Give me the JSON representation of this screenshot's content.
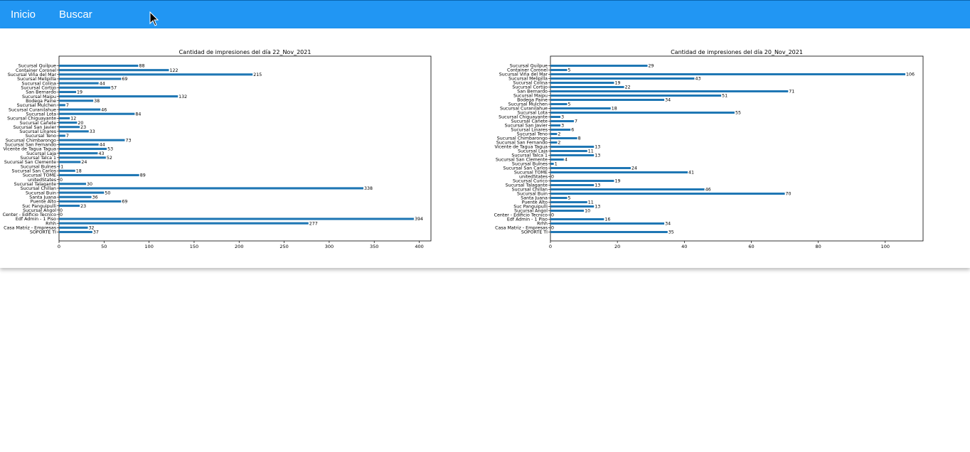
{
  "nav": {
    "inicio_label": "Inicio",
    "buscar_label": "Buscar"
  },
  "colors": {
    "navbar": "#2196f3",
    "bar": "#1f77b4",
    "nav_text": "#ffffff"
  },
  "icons": {
    "cursor": "mouse-pointer-icon"
  },
  "chart_data": [
    {
      "type": "bar",
      "orientation": "horizontal",
      "title": "Cantidad de impresiones del día 22_Nov_2021",
      "xlabel": "",
      "ylabel": "",
      "xlim": [
        0,
        413
      ],
      "xticks": [
        0,
        50,
        100,
        150,
        200,
        250,
        300,
        350,
        400
      ],
      "categories": [
        "Sucursal Quilpue",
        "Container Coronel",
        "Sucursal Viña del Mar",
        "Sucursal Melipilla",
        "Sucursal Colina",
        "Sucursal Cortijo",
        "San Bernardo",
        "Sucursal Maipu",
        "Bodega Paine",
        "Sucursal Mulchen",
        "Sucursal Curanilahue",
        "Sucursal Lota",
        "Sucursal Chiguayante",
        "Sucursal Cañete",
        "Sucursal San Javier",
        "Sucursal Linares",
        "Sucursal Teno",
        "Sucursal Chimbarongo",
        "Sucursal San Fernando",
        "Vicente de Tagua Tagua",
        "Sucursal Laja",
        "Sucursal Talca 1",
        "Sucursal San Clemente",
        "Sucursal Bulnes",
        "Sucursal San Carlos",
        "Sucursal TOME",
        "unitedStates",
        "Sucursal Talagante",
        "Sucursal Chillan",
        "Sucursal Buin",
        "Santa Juana",
        "Puente Alto",
        "Suc Panguipulli",
        "Sucursal Angol",
        "Center - Edificio Tecnico",
        "Edf Admin - 1 Piso",
        "Rrhh",
        "Casa Matriz - Empresas",
        "SOPORTE TI"
      ],
      "values": [
        88,
        122,
        215,
        69,
        44,
        57,
        19,
        132,
        38,
        7,
        46,
        84,
        12,
        20,
        23,
        33,
        7,
        73,
        44,
        53,
        43,
        52,
        24,
        1,
        18,
        89,
        0,
        30,
        338,
        50,
        36,
        69,
        23,
        0,
        0,
        394,
        277,
        32,
        37
      ],
      "grid": false,
      "legend": "none"
    },
    {
      "type": "bar",
      "orientation": "horizontal",
      "title": "Cantidad de impresiones del día 20_Nov_2021",
      "xlabel": "",
      "ylabel": "",
      "xlim": [
        0,
        111.3
      ],
      "xticks": [
        0,
        20,
        40,
        60,
        80,
        100
      ],
      "categories": [
        "Sucursal Quilpue",
        "Container Coronel",
        "Sucursal Viña del Mar",
        "Sucursal Melipilla",
        "Sucursal Colina",
        "Sucursal Cortijo",
        "San Bernardo",
        "Sucursal Maipu",
        "Bodega Paine",
        "Sucursal Mulchen",
        "Sucursal Curanilahue",
        "Sucursal Lota",
        "Sucursal Chiguayante",
        "Sucursal Cañete",
        "Sucursal San Javier",
        "Sucursal Linares",
        "Sucursal Teno",
        "Sucursal Chimbarongo",
        "Sucursal San Fernando",
        "Vicente de Tagua Tagua",
        "Sucursal Laja",
        "Sucursal Talca 1",
        "Sucursal San Clemente",
        "Sucursal Bulnes",
        "Sucursal San Carlos",
        "Sucursal TOME",
        "unitedStates",
        "Sucursal Curico",
        "Sucursal Talagante",
        "Sucursal Chillan",
        "Sucursal Buin",
        "Santa Juana",
        "Puente Alto",
        "Suc Panguipulli",
        "Sucursal Angol",
        "Center - Edificio Tecnico",
        "Edf Admin - 1 Piso",
        "Rrhh",
        "Casa Matriz - Empresas",
        "SOPORTE TI"
      ],
      "values": [
        29,
        5,
        106,
        43,
        19,
        22,
        71,
        51,
        34,
        5,
        18,
        55,
        3,
        7,
        3,
        6,
        2,
        8,
        2,
        13,
        11,
        13,
        4,
        1,
        24,
        41,
        0,
        19,
        13,
        46,
        70,
        5,
        11,
        13,
        10,
        0,
        16,
        34,
        0,
        35
      ],
      "grid": false,
      "legend": "none"
    }
  ]
}
